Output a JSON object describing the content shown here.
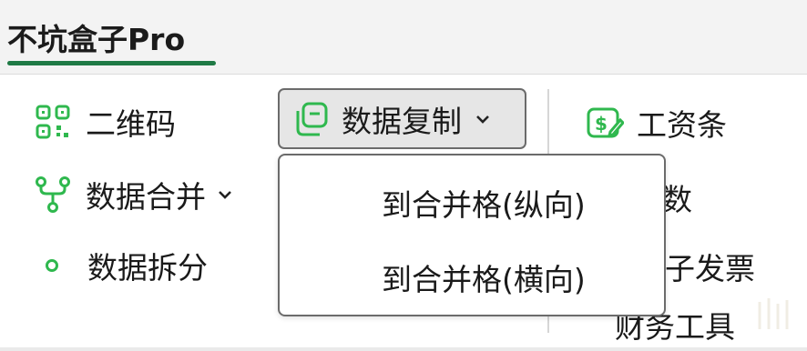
{
  "tab": {
    "title": "不坑盒子Pro"
  },
  "ribbon": {
    "left": [
      {
        "label": "二维码",
        "icon": "qr-code-icon"
      },
      {
        "label": "数据合并",
        "icon": "merge-fork-icon",
        "has_dropdown": true
      },
      {
        "label": "数据拆分",
        "icon": "dot-icon"
      }
    ],
    "copy_button": {
      "label": "数据复制",
      "icon": "copy-stack-icon",
      "has_dropdown": true
    },
    "right": [
      {
        "label": "工资条",
        "icon": "salary-slip-icon"
      },
      {
        "label": "参数",
        "visible_text": "数"
      },
      {
        "label": "电子发票",
        "visible_text": "子发票"
      },
      {
        "label": "财务工具"
      }
    ]
  },
  "dropdown_menu": {
    "items": [
      {
        "label": "到合并格(纵向)"
      },
      {
        "label": "到合并格(横向)"
      }
    ]
  },
  "colors": {
    "accent_green": "#2fb84e",
    "tab_underline": "#1f7a45"
  }
}
